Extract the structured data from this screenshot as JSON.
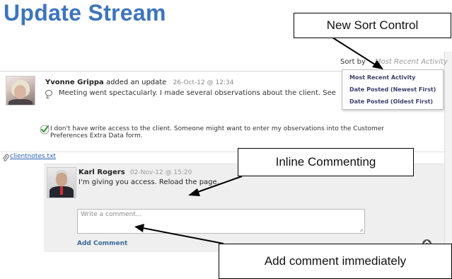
{
  "page": {
    "title": "Update Stream"
  },
  "sort": {
    "label": "Sort by",
    "selected": "Most Recent Activity",
    "options": [
      "Most Recent Activity",
      "Date Posted (Newest First)",
      "Date Posted (Oldest First)"
    ]
  },
  "post": {
    "author": "Yvonne Grippa",
    "action": "added an update",
    "date": "26-Oct-12 @ 12:34",
    "body": "Meeting went spectacularly. I made several observations about the client. See attached notes.",
    "note": "I don't have write access to the client. Someone might want to enter my observations into the Customer Preferences Extra Data form.",
    "attachment": "clientnotes.txt"
  },
  "comment": {
    "author": "Karl Rogers",
    "date": "02-Nov-12 @ 15:20",
    "body": "I'm giving you access. Reload the page.",
    "input_placeholder": "Write a comment...",
    "add_label": "Add Comment"
  },
  "callouts": {
    "sort": "New Sort Control",
    "inline": "Inline Commenting",
    "add": "Add comment immediately"
  },
  "colors": {
    "title": "#3d74bd",
    "link": "#2a62b3",
    "check": "#3a9d3a"
  }
}
